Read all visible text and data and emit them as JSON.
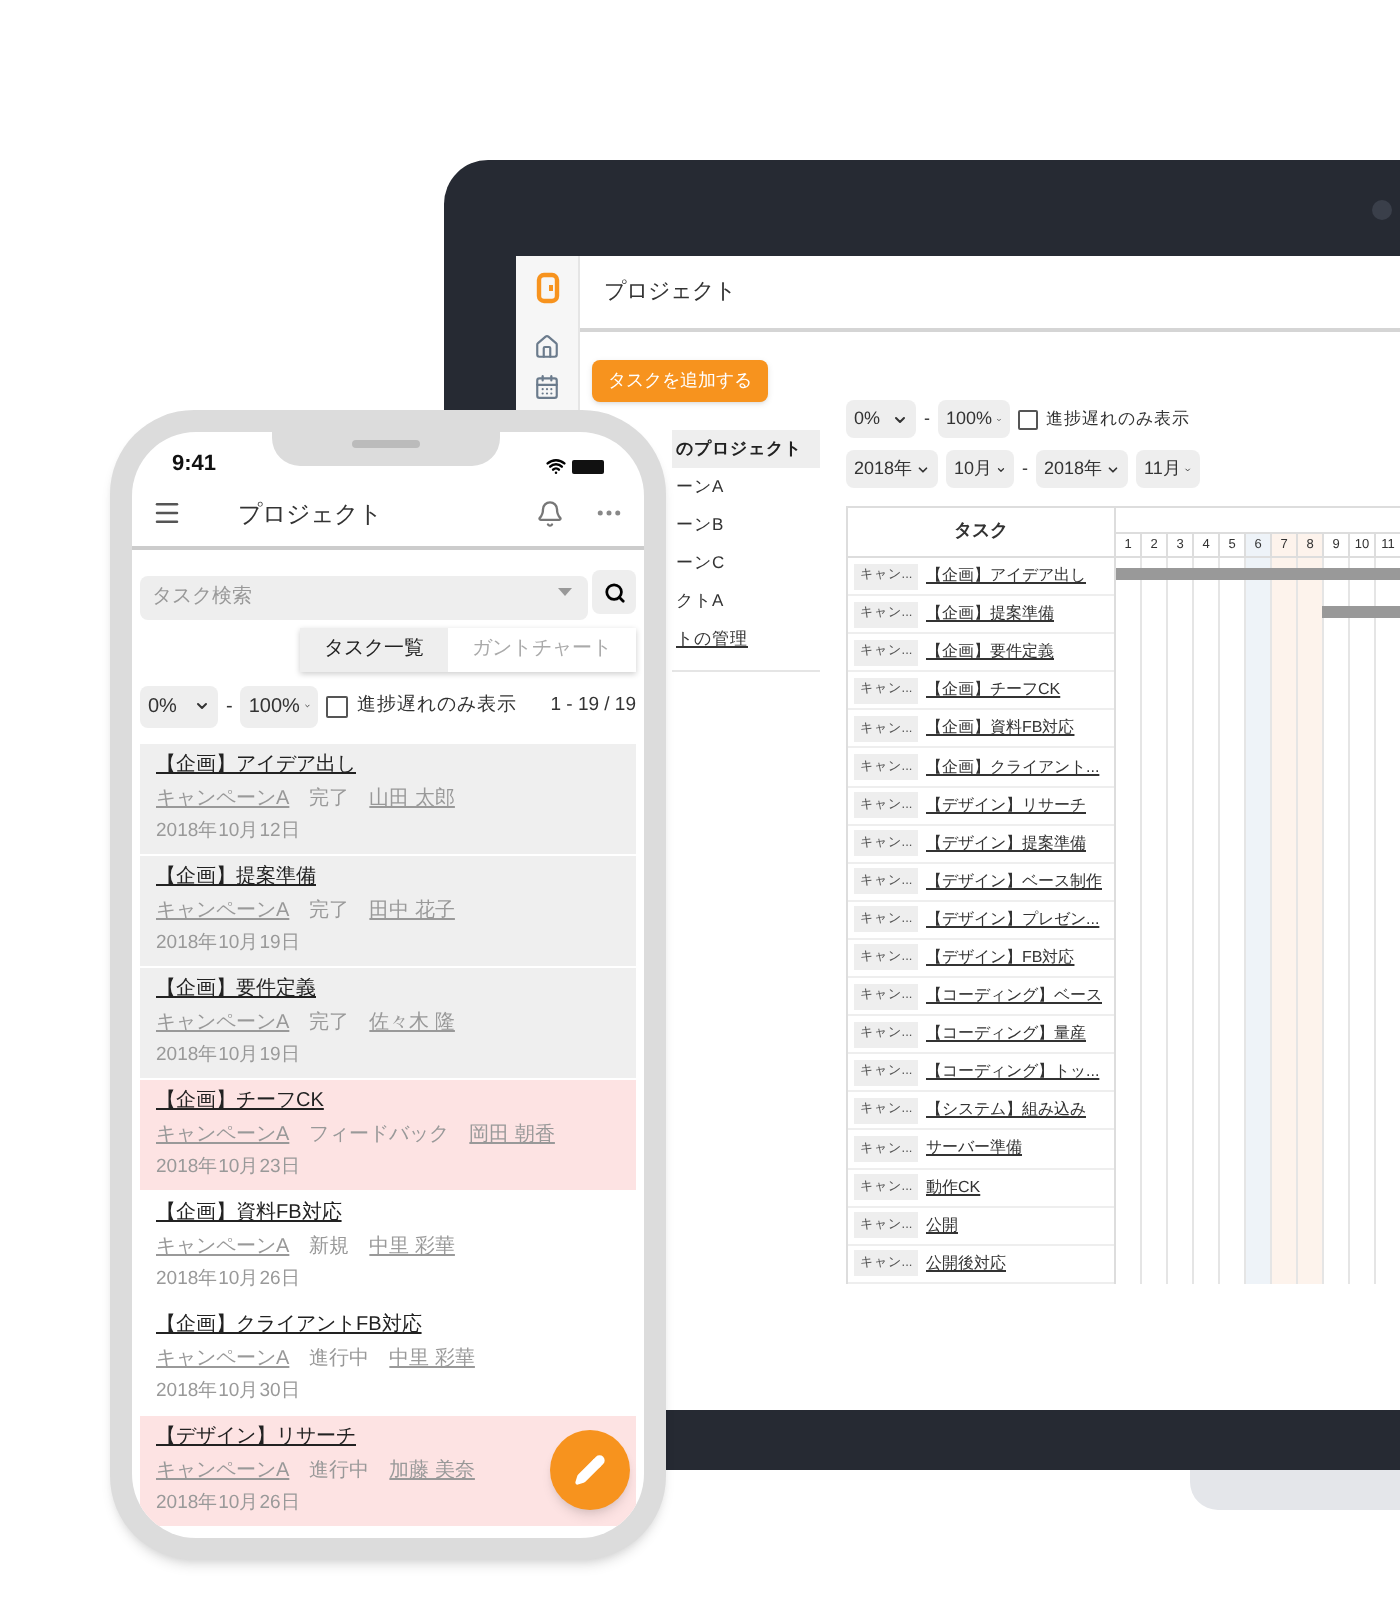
{
  "laptop": {
    "header_title": "プロジェクト",
    "add_button": "タスクを追加する",
    "project_list": [
      {
        "label": "のプロジェクト",
        "selected": true,
        "kind": "item"
      },
      {
        "label": "ーンA",
        "selected": false,
        "kind": "item"
      },
      {
        "label": "ーンB",
        "selected": false,
        "kind": "item"
      },
      {
        "label": "ーンC",
        "selected": false,
        "kind": "item"
      },
      {
        "label": "クトA",
        "selected": false,
        "kind": "item"
      },
      {
        "label": "トの管理",
        "selected": false,
        "kind": "link"
      }
    ],
    "progress_filter": {
      "min": "0%",
      "separator": "-",
      "max": "100%",
      "checkbox_label": "進捗遅れのみ表示",
      "checked": false
    },
    "date_filter": {
      "from_year": "2018年",
      "from_month": "10月",
      "separator": "-",
      "to_year": "2018年",
      "to_month": "11月"
    },
    "gantt": {
      "column_header": "タスク",
      "days": [
        {
          "label": "1",
          "kind": "weekday"
        },
        {
          "label": "2",
          "kind": "weekday"
        },
        {
          "label": "3",
          "kind": "weekday"
        },
        {
          "label": "4",
          "kind": "weekday"
        },
        {
          "label": "5",
          "kind": "weekday"
        },
        {
          "label": "6",
          "kind": "saturday"
        },
        {
          "label": "7",
          "kind": "holiday"
        },
        {
          "label": "8",
          "kind": "holiday"
        },
        {
          "label": "9",
          "kind": "weekday"
        },
        {
          "label": "10",
          "kind": "weekday"
        },
        {
          "label": "11",
          "kind": "weekday"
        }
      ],
      "rows": [
        {
          "tag": "キャン...",
          "task": "【企画】アイデア出し",
          "kind": "span"
        },
        {
          "tag": "キャン...",
          "task": "【企画】提案準備",
          "kind": "tail"
        },
        {
          "tag": "キャン...",
          "task": "【企画】要件定義"
        },
        {
          "tag": "キャン...",
          "task": "【企画】チーフCK"
        },
        {
          "tag": "キャン...",
          "task": "【企画】資料FB対応"
        },
        {
          "tag": "キャン...",
          "task": "【企画】クライアント..."
        },
        {
          "tag": "キャン...",
          "task": "【デザイン】リサーチ"
        },
        {
          "tag": "キャン...",
          "task": "【デザイン】提案準備"
        },
        {
          "tag": "キャン...",
          "task": "【デザイン】ベース制作"
        },
        {
          "tag": "キャン...",
          "task": "【デザイン】プレゼン..."
        },
        {
          "tag": "キャン...",
          "task": "【デザイン】FB対応"
        },
        {
          "tag": "キャン...",
          "task": "【コーディング】ベース"
        },
        {
          "tag": "キャン...",
          "task": "【コーディング】量産"
        },
        {
          "tag": "キャン...",
          "task": "【コーディング】トッ..."
        },
        {
          "tag": "キャン...",
          "task": "【システム】組み込み"
        },
        {
          "tag": "キャン...",
          "task": "サーバー準備"
        },
        {
          "tag": "キャン...",
          "task": "動作CK"
        },
        {
          "tag": "キャン...",
          "task": "公開"
        },
        {
          "tag": "キャン...",
          "task": "公開後対応"
        }
      ]
    }
  },
  "phone": {
    "time": "9:41",
    "header_title": "プロジェクト",
    "search": {
      "placeholder": "タスク検索"
    },
    "tabs": [
      {
        "label": "タスク一覧",
        "selected": true
      },
      {
        "label": "ガントチャート",
        "selected": false
      }
    ],
    "progress_filter": {
      "min": "0%",
      "separator": "-",
      "max": "100%",
      "checkbox_label": "進捗遅れのみ表示",
      "checked": false
    },
    "count": "1 - 19 / 19",
    "tasks": [
      {
        "title": "【企画】アイデア出し",
        "campaign": "キャンペーンA",
        "status": "完了",
        "assignee": "山田 太郎",
        "date": "2018年10月12日",
        "kind": "done"
      },
      {
        "title": "【企画】提案準備",
        "campaign": "キャンペーンA",
        "status": "完了",
        "assignee": "田中 花子",
        "date": "2018年10月19日",
        "kind": "done"
      },
      {
        "title": "【企画】要件定義",
        "campaign": "キャンペーンA",
        "status": "完了",
        "assignee": "佐々木 隆",
        "date": "2018年10月19日",
        "kind": "done"
      },
      {
        "title": "【企画】チーフCK",
        "campaign": "キャンペーンA",
        "status": "フィードバック",
        "assignee": "岡田 朝香",
        "date": "2018年10月23日",
        "kind": "late"
      },
      {
        "title": "【企画】資料FB対応",
        "campaign": "キャンペーンA",
        "status": "新規",
        "assignee": "中里 彩華",
        "date": "2018年10月26日",
        "kind": "normal"
      },
      {
        "title": "【企画】クライアントFB対応",
        "campaign": "キャンペーンA",
        "status": "進行中",
        "assignee": "中里 彩華",
        "date": "2018年10月30日",
        "kind": "normal"
      },
      {
        "title": "【デザイン】リサーチ",
        "campaign": "キャンペーンA",
        "status": "進行中",
        "assignee": "加藤 美奈",
        "date": "2018年10月26日",
        "kind": "late"
      }
    ]
  }
}
